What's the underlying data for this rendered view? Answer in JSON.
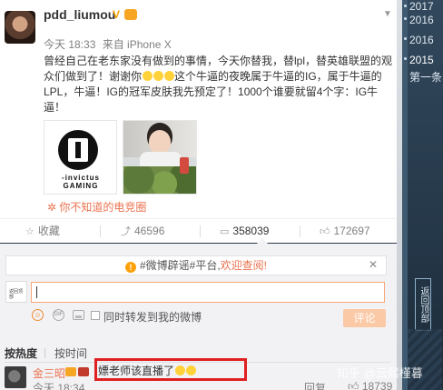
{
  "post": {
    "username": "pdd_liumou",
    "time": "今天 18:33",
    "source": "来自 iPhone X",
    "text_part1": "曾经自己在老东家没有做到的事情，今天你替我，替lpl，替英雄联盟的观众们做到了！谢谢你",
    "text_part2": "这个牛逼的夜晚属于牛逼的IG，属于牛逼的LPL，牛逼！IG的冠军皮肤我先预定了！1000个谁要就留4个字：IG牛逼！",
    "emoji_count": 3,
    "logo_text_line1": "-invictus",
    "logo_text_line2": "GAMING",
    "tag_link": "你不知道的电竞圈"
  },
  "actions": {
    "favorite": "收藏",
    "forward": "46596",
    "comment": "358039",
    "like": "172697"
  },
  "comment_box": {
    "notice_prefix": "#微博辟谣#平台,",
    "notice_link": "欢迎查阅!",
    "close": "✕",
    "forward_label": "同时转发到我的微博",
    "submit": "评论",
    "avatar_text": "返回顶部"
  },
  "sort": {
    "hot": "按热度",
    "time": "按时间"
  },
  "comment": {
    "name": "金三昭",
    "text": "嫖老师该直播了",
    "time": "今天 18:34",
    "reply": "回复",
    "likes": "18739"
  },
  "sidebar": {
    "years": [
      "2017",
      "2016",
      "2016",
      "2015"
    ],
    "current_label": "第一条",
    "back_top": "返回顶部"
  },
  "watermark": "知乎 @云熙槿暮",
  "colors": {
    "accent": "#eb7350",
    "highlight_box": "#e02020",
    "submit_bg": "#fbc9a6"
  }
}
